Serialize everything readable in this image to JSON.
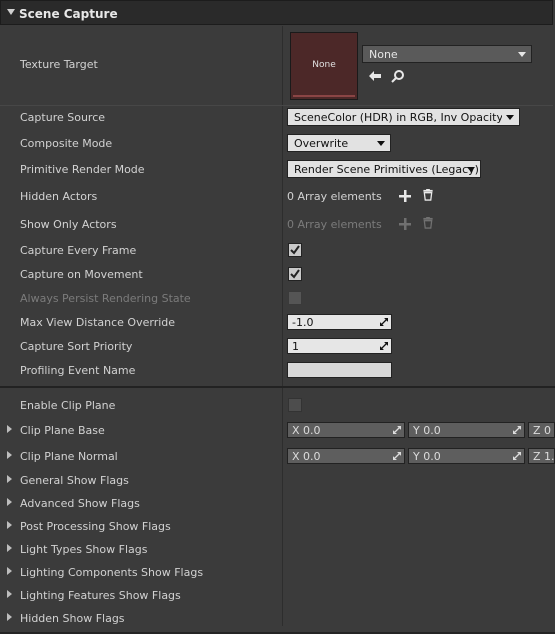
{
  "section": {
    "title": "Scene Capture"
  },
  "texture_target": {
    "label": "Texture Target",
    "thumb_text": "None",
    "combo_value": "None"
  },
  "capture_source": {
    "label": "Capture Source",
    "value": "SceneColor (HDR) in RGB, Inv Opacity in A"
  },
  "composite_mode": {
    "label": "Composite Mode",
    "value": "Overwrite"
  },
  "primitive_render_mode": {
    "label": "Primitive Render Mode",
    "value": "Render Scene Primitives (Legacy)"
  },
  "hidden_actors": {
    "label": "Hidden Actors",
    "value": "0 Array elements"
  },
  "show_only_actors": {
    "label": "Show Only Actors",
    "value": "0 Array elements"
  },
  "capture_every_frame": {
    "label": "Capture Every Frame",
    "checked": true
  },
  "capture_on_movement": {
    "label": "Capture on Movement",
    "checked": true
  },
  "always_persist": {
    "label": "Always Persist Rendering State",
    "checked": false
  },
  "max_view_distance": {
    "label": "Max View Distance Override",
    "value": "-1.0"
  },
  "capture_sort_priority": {
    "label": "Capture Sort Priority",
    "value": "1"
  },
  "profiling_event_name": {
    "label": "Profiling Event Name",
    "value": ""
  },
  "enable_clip_plane": {
    "label": "Enable Clip Plane",
    "checked": false
  },
  "clip_plane_base": {
    "label": "Clip Plane Base",
    "x": "X 0.0",
    "y": "Y 0.0",
    "z": "Z 0"
  },
  "clip_plane_normal": {
    "label": "Clip Plane Normal",
    "x": "X 0.0",
    "y": "Y 0.0",
    "z": "Z 1."
  },
  "show_flags": [
    "General Show Flags",
    "Advanced Show Flags",
    "Post Processing Show Flags",
    "Light Types Show Flags",
    "Lighting Components Show Flags",
    "Lighting Features Show Flags",
    "Hidden Show Flags"
  ]
}
